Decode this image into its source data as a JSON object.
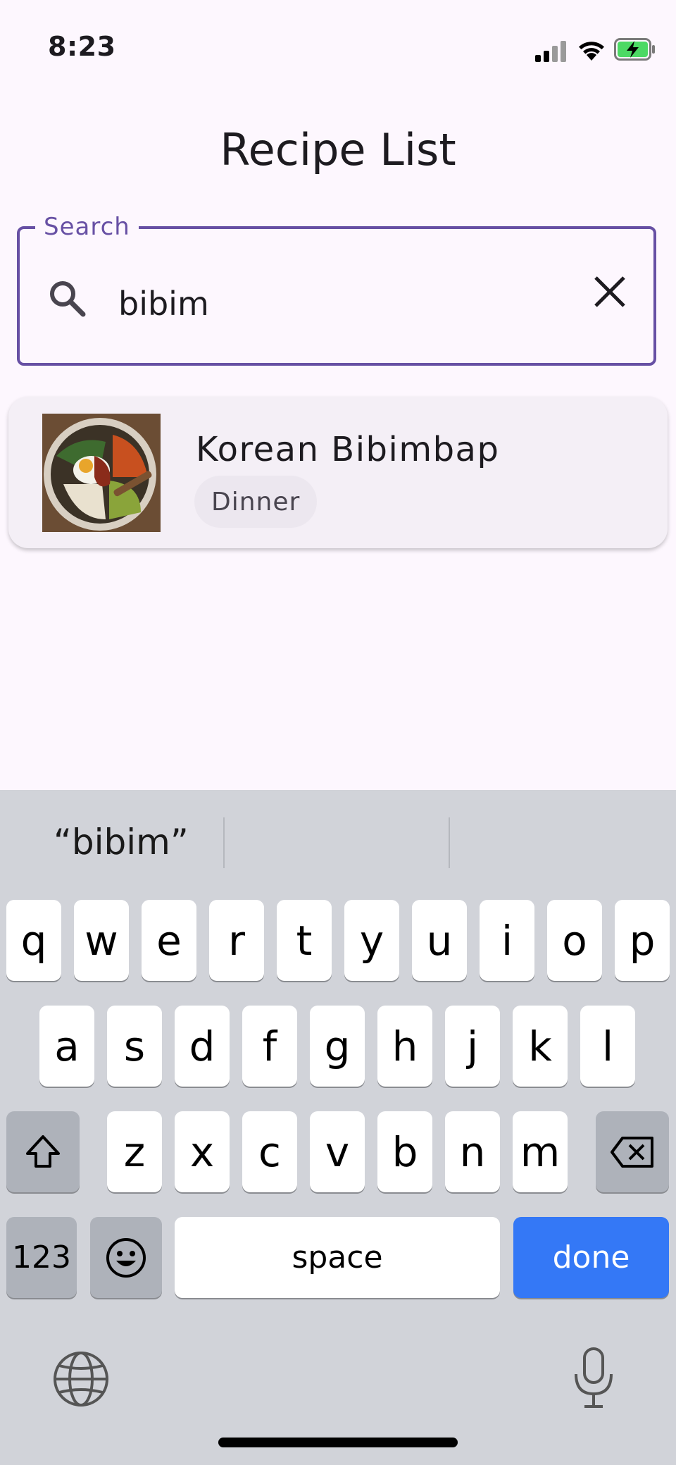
{
  "status_bar": {
    "time": "8:23"
  },
  "header": {
    "title": "Recipe List"
  },
  "search": {
    "label": "Search",
    "value": "bibim"
  },
  "results": [
    {
      "title": "Korean Bibimbap",
      "category": "Dinner"
    }
  ],
  "keyboard": {
    "suggestions": [
      "“bibim”",
      "",
      ""
    ],
    "row1": [
      "q",
      "w",
      "e",
      "r",
      "t",
      "y",
      "u",
      "i",
      "o",
      "p"
    ],
    "row2": [
      "a",
      "s",
      "d",
      "f",
      "g",
      "h",
      "j",
      "k",
      "l"
    ],
    "row3": [
      "z",
      "x",
      "c",
      "v",
      "b",
      "n",
      "m"
    ],
    "numbers_key": "123",
    "space_key": "space",
    "done_key": "done"
  },
  "colors": {
    "accent": "#6750a4",
    "done_key": "#3478f6",
    "keyboard_bg": "#d1d3d9",
    "battery": "#4cd964"
  }
}
